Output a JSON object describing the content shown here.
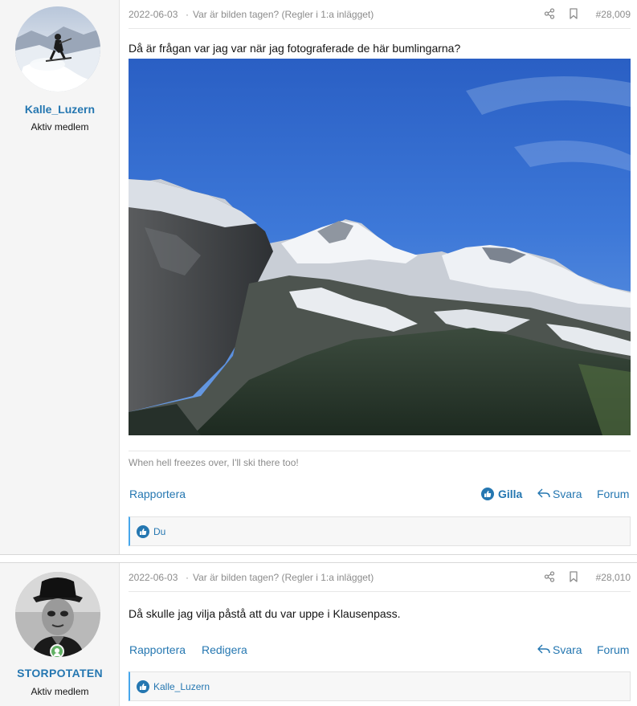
{
  "posts": [
    {
      "author": "Kalle_Luzern",
      "user_title": "Aktiv medlem",
      "date": "2022-06-03",
      "separator": "·",
      "thread_title": "Var är bilden tagen? (Regler i 1:a inlägget)",
      "post_number": "#28,009",
      "text": "Då är frågan var jag var när jag fotograferade de här bumlingarna?",
      "signature": "When hell freezes over, I'll ski there too!",
      "actions": {
        "report": "Rapportera",
        "like": "Gilla",
        "reply": "Svara",
        "forum": "Forum"
      },
      "reactions_text": "Du"
    },
    {
      "author": "STORPOTATEN",
      "user_title": "Aktiv medlem",
      "date": "2022-06-03",
      "separator": "·",
      "thread_title": "Var är bilden tagen? (Regler i 1:a inlägget)",
      "post_number": "#28,010",
      "text": "Då skulle jag vilja påstå att du var uppe i Klausenpass.",
      "actions": {
        "report": "Rapportera",
        "edit": "Redigera",
        "reply": "Svara",
        "forum": "Forum"
      },
      "reactions_text": "Kalle_Luzern"
    }
  ],
  "icons": {
    "share": "share-icon",
    "bookmark": "bookmark-icon",
    "like": "thumbs-up-icon",
    "reply": "reply-arrow-icon",
    "online": "online-user-icon"
  },
  "colors": {
    "link": "#2577b1",
    "muted": "#8c8c8c",
    "online": "#63b265",
    "reaction_accent": "#47a7eb"
  }
}
